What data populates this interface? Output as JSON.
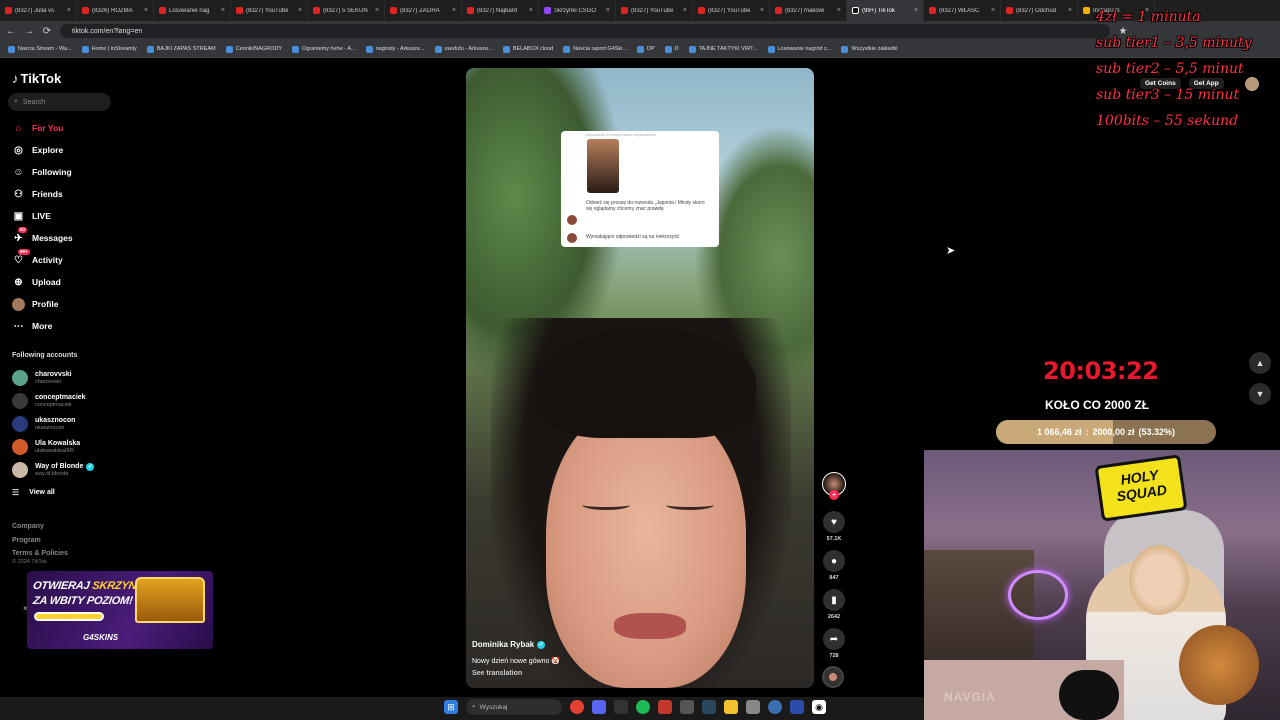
{
  "browser": {
    "tabs": [
      {
        "label": "(8327) Julia vs",
        "icon": "youtube-icon"
      },
      {
        "label": "(8326) ROZMA",
        "icon": "youtube-icon"
      },
      {
        "label": "Losowanie nag",
        "icon": "youtube-icon"
      },
      {
        "label": "(8327) YouTube",
        "icon": "youtube-icon"
      },
      {
        "label": "(8327) 5 SEKUN",
        "icon": "youtube-icon"
      },
      {
        "label": "(8327) ZAORA",
        "icon": "youtube-icon"
      },
      {
        "label": "(8327) Najbard",
        "icon": "youtube-icon"
      },
      {
        "label": "Skrzynki CSGO",
        "icon": "plugin-icon"
      },
      {
        "label": "(8327) YouTube",
        "icon": "youtube-icon"
      },
      {
        "label": "(8327) YouTube",
        "icon": "youtube-icon"
      },
      {
        "label": "(8327) makowi",
        "icon": "youtube-icon"
      },
      {
        "label": "(99+) TikTok",
        "icon": "tiktok-icon",
        "active": true
      },
      {
        "label": "(8327) WŁAŚC",
        "icon": "youtube-icon"
      },
      {
        "label": "(8327) Odchud",
        "icon": "youtube-icon"
      },
      {
        "label": "Instagram",
        "icon": "instagram-icon"
      }
    ],
    "url": "tiktok.com/en?lang=en",
    "bookmarks": [
      "Navcia Stream - Wa...",
      "Home | inStreamly",
      "BAJKI ZAPAS STREAM",
      "Cennik/NAGRODY",
      "Ograniemy hehe - A...",
      "nagrody - Arkusze...",
      "uwufufu - Arkusze...",
      "BELABOX cloud",
      "Navcia raport G4Ski...",
      "DP",
      "D",
      "TAJNE TAKTYKI VIRT...",
      "Losowanie nagród z...",
      "Wszystkie zakładki"
    ]
  },
  "tiktok": {
    "logo": "TikTok",
    "search_placeholder": "Search",
    "nav": [
      {
        "label": "For You",
        "icon": "home-icon",
        "active": true
      },
      {
        "label": "Explore",
        "icon": "compass-icon"
      },
      {
        "label": "Following",
        "icon": "following-icon"
      },
      {
        "label": "Friends",
        "icon": "friends-icon"
      },
      {
        "label": "LIVE",
        "icon": "live-icon"
      },
      {
        "label": "Messages",
        "icon": "message-icon",
        "badge": "53"
      },
      {
        "label": "Activity",
        "icon": "activity-icon",
        "badge": "99+"
      },
      {
        "label": "Upload",
        "icon": "upload-icon"
      },
      {
        "label": "Profile",
        "icon": "avatar-icon"
      },
      {
        "label": "More",
        "icon": "more-icon"
      }
    ],
    "following_title": "Following accounts",
    "accounts": [
      {
        "name": "charovvski",
        "handle": "charovvski",
        "color": "#5aa38a"
      },
      {
        "name": "conceptmaciek",
        "handle": "conceptmaciek",
        "color": "#3a3a3a"
      },
      {
        "name": "ukasznocon",
        "handle": "ukasznocon",
        "color": "#2a3a7a"
      },
      {
        "name": "Ula Kowalska",
        "handle": "ulakowalska005",
        "color": "#d25a2a"
      },
      {
        "name": "Way of Blonde",
        "handle": "way.of.blonde",
        "color": "#c8b8a8",
        "verified": true
      }
    ],
    "view_all": "View all",
    "footer_links": [
      "Company",
      "Program",
      "Terms & Policies"
    ],
    "copyright": "© 2024 TikTok",
    "top_buttons": [
      "Get Coins",
      "Get App"
    ]
  },
  "video": {
    "card_header": "Odpowiedz do komentarza użytkownika",
    "comment_text": "Odnieś się proszę do rozwodu „Japonia i Mindy skoro się oglądamy chcemy znać prawdę",
    "card_replies": "Wyniakające odpowiedzi są na niekorzyść",
    "author": "Dominika Rybak",
    "description": "Nowy dzień nowe gówno 🤡",
    "translate": "See translation",
    "likes": "57.1K",
    "comments": "847",
    "saves": "2642",
    "shares": "728"
  },
  "overlay": {
    "pricing": [
      "4zł = 1 minuta",
      "sub tier1 – 3,5 minuty",
      "sub tier2 – 5,5 minut",
      "sub tier3 – 15 minut",
      "100bits – 55 sekund"
    ],
    "timer": "20:03:22",
    "goal_title": "KOŁO CO 2000 ZŁ",
    "goal_current": "1 066,46 zł",
    "goal_sep": ":",
    "goal_target": "2000,00 zł",
    "goal_percent_text": "(53.32%)",
    "goal_fraction": 0.5332,
    "holy_text": "HOLY SQUAD",
    "webcam_text": "NAVGIA"
  },
  "ad": {
    "line1a": "OTWIERAJ ",
    "line1b": "SKRZYNKI EXP",
    "line2": "ZA WBITY POZIOM!",
    "brand": "G4SKINS"
  },
  "taskbar": {
    "search_placeholder": "Wyszukaj"
  },
  "colors": {
    "tiktok_accent": "#fe2c55",
    "timer_red": "#e8192c",
    "pricing_red": "#ff2f40",
    "goal_fill": "#c9a978"
  }
}
